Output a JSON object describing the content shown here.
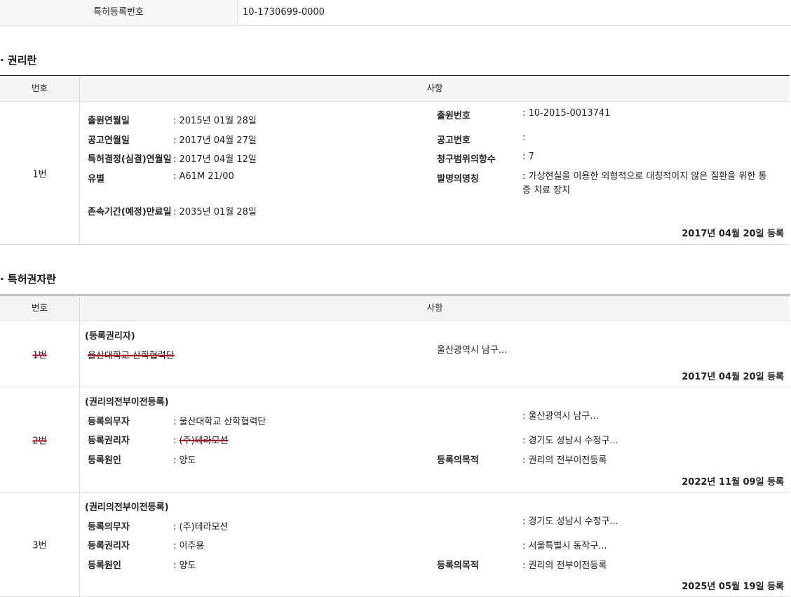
{
  "top": {
    "label": "특허등록번호",
    "value": "10-1730699-0000"
  },
  "rights": {
    "title": "· 권리란",
    "header_no": "번호",
    "header_item": "사항",
    "row_no": "1번",
    "left": [
      {
        "label": "출원연월일",
        "value": ": 2015년 01월 28일"
      },
      {
        "label": "공고연월일",
        "value": ": 2017년 04월 27일"
      },
      {
        "label": "특허결정(심결)연월일",
        "value": ": 2017년 04월 12일"
      },
      {
        "label": "유별",
        "value": ": A61M 21/00"
      },
      {
        "label": "존속기간(예정)만료일",
        "value": ": 2035년 01월 28일"
      }
    ],
    "right": [
      {
        "label": "출원번호",
        "value": ": 10-2015-0013741"
      },
      {
        "label": "공고번호",
        "value": ":"
      },
      {
        "label": "청구범위의항수",
        "value": ": 7"
      },
      {
        "label": "발명의명칭",
        "value": ": 가상현실을 이용한 외형적으로 대칭적이지 않은 질환을 위한 통증 치료 장치"
      }
    ],
    "registered": "2017년 04월 20일 등록"
  },
  "holders": {
    "title": "· 특허권자란",
    "header_no": "번호",
    "header_item": "사항",
    "rows": [
      {
        "no": "1번",
        "type": "(등록권리자)",
        "name": "울산대학교 산학협력단",
        "address": "울산광역시 남구...",
        "registered": "2017년 04월 20일 등록"
      },
      {
        "no": "2번",
        "type": "(권리의전부이전등록)",
        "obligor_label": "등록의무자",
        "obligor": ": 울산대학교 산학협력단",
        "obligor_addr": ": 울산광역시 남구...",
        "holder_label": "등록권리자",
        "holder_prefix": ": ",
        "holder": "(주)테라모션",
        "holder_addr": ": 경기도 성남시 수정구...",
        "cause_label": "등록원인",
        "cause": ": 양도",
        "purpose_label": "등록의목적",
        "purpose": ": 권리의 전부이전등록",
        "registered": "2022년 11월 09일 등록"
      },
      {
        "no": "3번",
        "type": "(권리의전부이전등록)",
        "obligor_label": "등록의무자",
        "obligor": ": (주)테라모션",
        "obligor_addr": ": 경기도 성남시 수정구...",
        "holder_label": "등록권리자",
        "holder": ": 이주용",
        "holder_addr": ": 서울특별시 동작구...",
        "cause_label": "등록원인",
        "cause": ": 양도",
        "purpose_label": "등록의목적",
        "purpose": ": 권리의 전부이전등록",
        "registered": "2025년 05월 19일 등록"
      }
    ]
  }
}
